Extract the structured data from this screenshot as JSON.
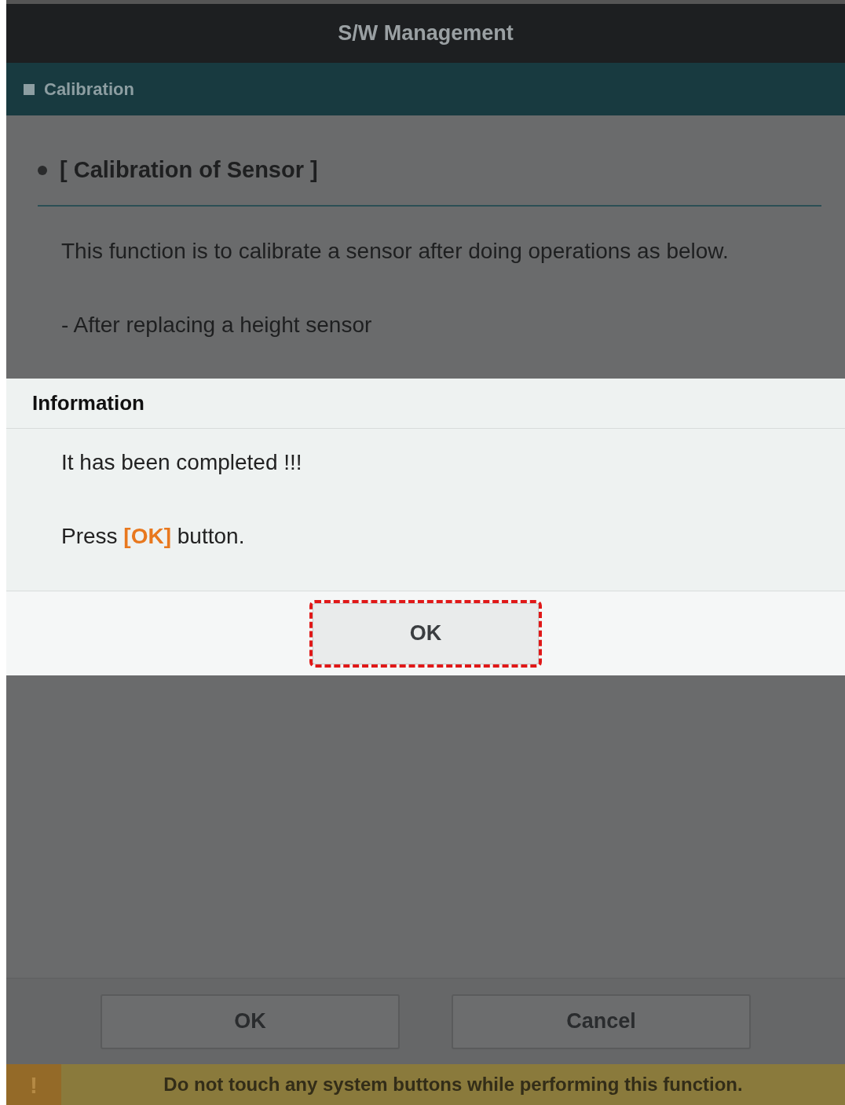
{
  "window": {
    "title": "S/W Management"
  },
  "section_header": {
    "label": "Calibration"
  },
  "content": {
    "heading": "[ Calibration of Sensor ]",
    "lines": [
      "This function is to calibrate a sensor after doing operations as below.",
      "- After replacing a height sensor"
    ]
  },
  "dialog": {
    "title": "Information",
    "message": "It has been completed !!!",
    "instruction": {
      "before": "Press ",
      "highlight": "[OK]",
      "after": " button."
    },
    "button": {
      "label": "OK",
      "highlighted": true
    }
  },
  "footer_buttons": [
    {
      "label": "OK"
    },
    {
      "label": "Cancel"
    }
  ],
  "warning": {
    "icon": "!",
    "text": "Do not touch any system buttons while performing this function."
  }
}
